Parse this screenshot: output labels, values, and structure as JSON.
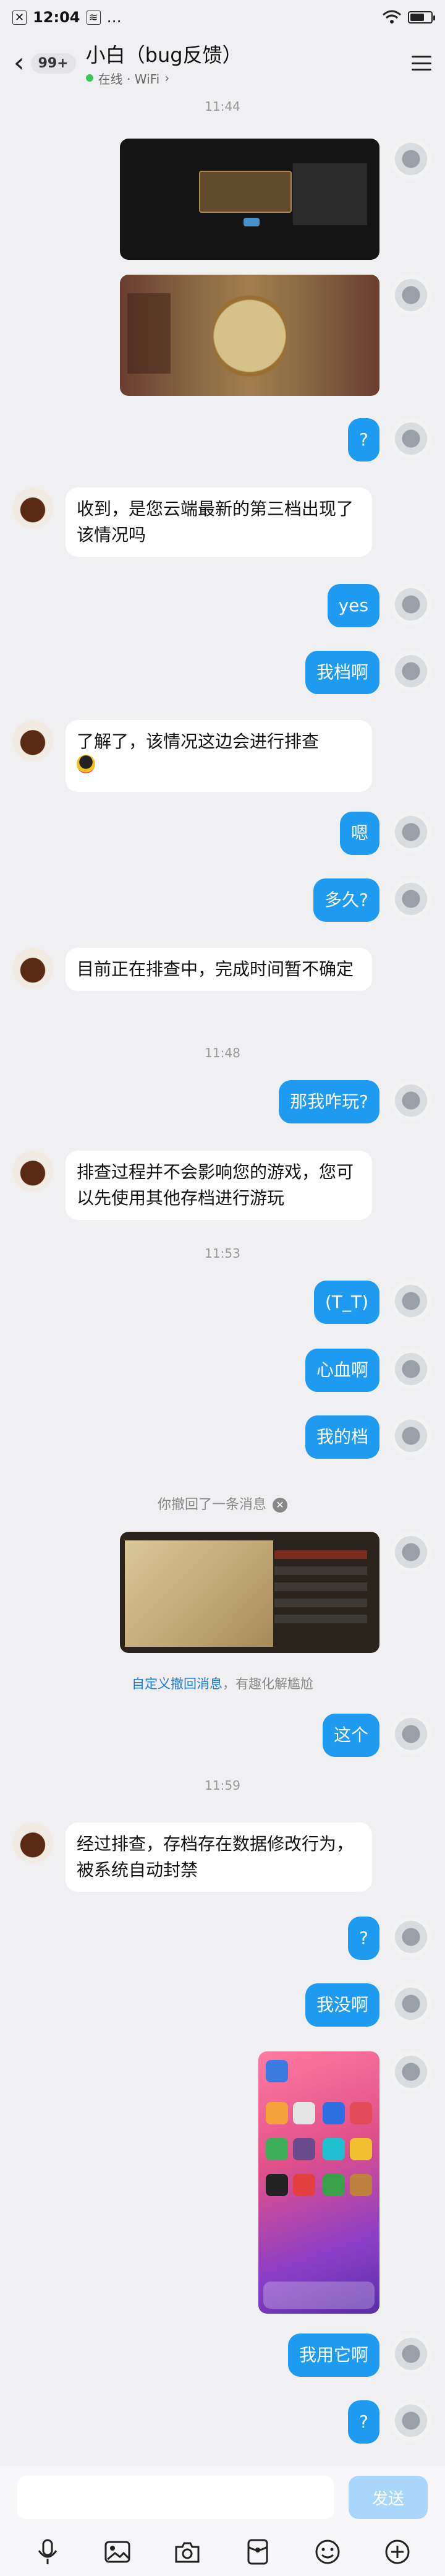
{
  "status_bar": {
    "time": "12:04",
    "extra": "…"
  },
  "header": {
    "unread_badge": "99+",
    "title": "小白（bug反馈）",
    "status": "在线 · WiFi",
    "icons": [
      "back-arrow-icon",
      "menu-icon"
    ]
  },
  "timestamps": {
    "t1": "11:44",
    "t2": "11:48",
    "t3": "11:53",
    "t4": "11:59"
  },
  "messages": {
    "m1": "?",
    "m2": "收到，是您云端最新的第三档出现了该情况吗",
    "m3": "yes",
    "m4": "我档啊",
    "m5": "了解了，该情况这边会进行排查",
    "m6": "嗯",
    "m7": "多久?",
    "m8": "目前正在排查中，完成时间暂不确定",
    "m9": "那我咋玩?",
    "m10": "排查过程并不会影响您的游戏，您可以先使用其他存档进行游玩",
    "m11": "(T_T)",
    "m12": "心血啊",
    "m13": "我的档",
    "m14": "这个",
    "m15": "经过排查，存档存在数据修改行为，被系统自动封禁",
    "m16": "?",
    "m17": "我没啊",
    "m18": "我用它啊",
    "m19": "?"
  },
  "recall": {
    "text": "你撤回了一条消息",
    "hint_link": "自定义撤回消息",
    "hint_rest": "，有趣化解尴尬"
  },
  "input": {
    "placeholder": "",
    "send_label": "发送"
  },
  "toolbar_icons": [
    "microphone-icon",
    "image-icon",
    "camera-icon",
    "red-packet-icon",
    "emoji-icon",
    "plus-icon"
  ],
  "colors": {
    "bubble_out": "#1e9bf0",
    "send_disabled": "#a9d6fa",
    "online": "#3bc45a"
  }
}
